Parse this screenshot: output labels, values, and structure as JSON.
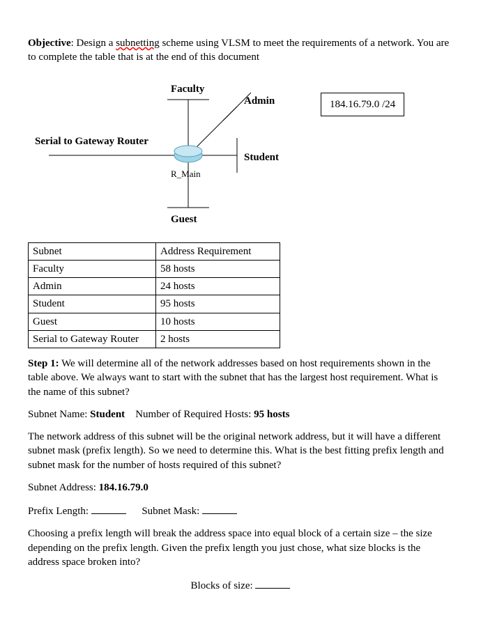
{
  "objective": {
    "label": "Objective",
    "squiggly_word": "subnetting",
    "text_after": " scheme using VLSM to meet the requirements of a network. You are to complete the table that is at the end of this document",
    "text_before": ": Design a "
  },
  "diagram": {
    "faculty": "Faculty",
    "admin": "Admin",
    "serial": "Serial to Gateway Router",
    "student": "Student",
    "guest": "Guest",
    "router_name": "R_Main",
    "ip_block": "184.16.79.0 /24"
  },
  "table": {
    "header_subnet": "Subnet",
    "header_req": "Address Requirement",
    "rows": [
      {
        "subnet": "Faculty",
        "req": "58 hosts"
      },
      {
        "subnet": "Admin",
        "req": "24 hosts"
      },
      {
        "subnet": "Student",
        "req": "95 hosts"
      },
      {
        "subnet": "Guest",
        "req": "10 hosts"
      },
      {
        "subnet": "Serial to Gateway Router",
        "req": "2 hosts"
      }
    ]
  },
  "step1": {
    "label": "Step 1:",
    "text": " We will determine all of the network addresses based on host requirements shown in the table above. We always want to start with the subnet that has the largest host requirement. What is the name of this subnet?"
  },
  "answers": {
    "subnet_name_label": "Subnet Name: ",
    "subnet_name_value": "Student",
    "num_hosts_label": "    Number of Required Hosts: ",
    "num_hosts_value": "95 hosts"
  },
  "para2": "The network address of this subnet will be the original network address, but it will have a different subnet mask (prefix length). So we need to determine this. What is the best fitting prefix length and subnet mask for the number of hosts required of this subnet?",
  "subnet_addr": {
    "label": "Subnet Address: ",
    "value": "184.16.79.0"
  },
  "prefix_line": {
    "prefix_label": "Prefix Length: ",
    "mask_label": "Subnet Mask: "
  },
  "para3": "Choosing a prefix length will break the address space into equal block of a certain size – the size depending on the prefix length. Given the prefix length you just chose, what size blocks is the address space broken into?",
  "blocks_label": "Blocks of size: "
}
